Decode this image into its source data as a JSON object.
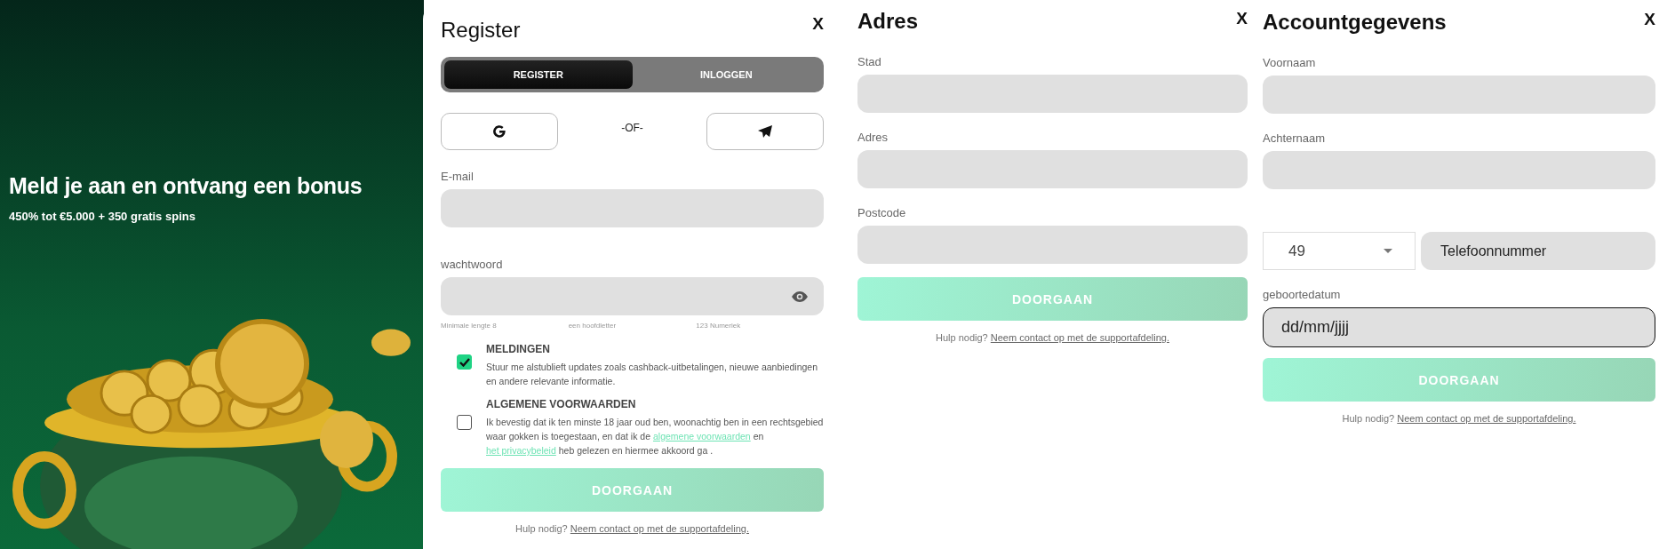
{
  "promo": {
    "title": "Meld je aan en ontvang een bonus",
    "subtitle": "450% tot €5.000 + 350 gratis spins",
    "kind": "picture"
  },
  "register": {
    "title": "Register",
    "close": "X",
    "tabs": [
      {
        "label": "REGISTER",
        "selected": true
      },
      {
        "label": "INLOGGEN",
        "selected": false
      }
    ],
    "or_text": "-OF-",
    "fields": [
      {
        "label": "E-mail",
        "kind": "text"
      },
      {
        "label": "wachtwoord",
        "kind": "password"
      }
    ],
    "password_hints": [
      "Minimale lengte 8",
      "een hoofdletter",
      "123 Numeriek"
    ],
    "consents": [
      {
        "title": "MELDINGEN",
        "checked": true,
        "parts": [
          {
            "kind": "text",
            "text": "Stuur me alstublieft updates zoals cashback-uitbetalingen, nieuwe aanbiedingen en andere relevante informatie."
          }
        ]
      },
      {
        "title": "ALGEMENE VOORWAARDEN",
        "checked": false,
        "parts": [
          {
            "kind": "text",
            "text": "Ik bevestig dat ik ten minste 18 jaar oud ben, woonachtig ben in een rechtsgebied waar gokken is toegestaan, en dat ik de "
          },
          {
            "kind": "link",
            "text": "algemene voorwaarden"
          },
          {
            "kind": "text",
            "text": " en "
          },
          {
            "kind": "link",
            "text": "het privacybeleid"
          },
          {
            "kind": "text",
            "text": " heb gelezen en hiermee akkoord ga ."
          }
        ]
      }
    ],
    "submit": {
      "label": "DOORGAAN",
      "disabled": true
    },
    "help": {
      "text": "Hulp nodig?",
      "link": "Neem contact op met de supportafdeling."
    }
  },
  "address": {
    "title": "Adres",
    "close": "X",
    "fields": [
      {
        "label": "Stad",
        "kind": "text"
      },
      {
        "label": "Adres",
        "kind": "text"
      },
      {
        "label": "Postcode",
        "kind": "text"
      }
    ],
    "submit": {
      "label": "DOORGAAN",
      "disabled": true
    },
    "help": {
      "text": "Hulp nodig?",
      "link": "Neem contact op met de supportafdeling."
    }
  },
  "account": {
    "title": "Accountgegevens",
    "close": "X",
    "fields": [
      {
        "label": "Voornaam",
        "kind": "text"
      },
      {
        "label": "Achternaam",
        "kind": "text"
      },
      {
        "kind": "phone",
        "country_code": "49",
        "placeholder": "Telefoonnummer"
      },
      {
        "label": "geboortedatum",
        "kind": "date",
        "placeholder": "dd/mm/jjjj",
        "focused": true
      }
    ],
    "submit": {
      "label": "DOORGAAN",
      "disabled": true
    },
    "help": {
      "text": "Hulp nodig?",
      "link": "Neem contact op met de supportafdeling."
    }
  }
}
